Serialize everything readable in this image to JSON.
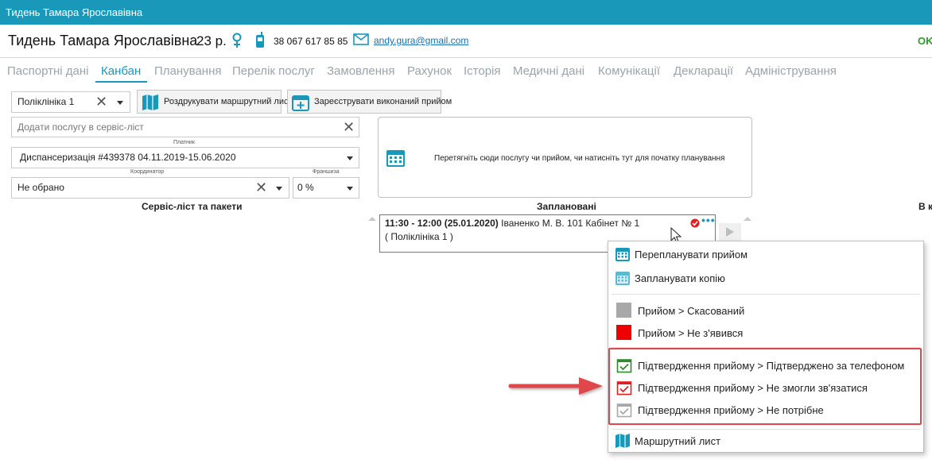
{
  "window": {
    "title": "Тидень Тамара Ярославівна"
  },
  "header": {
    "name": "Тидень Тамара Ярославівна",
    "age": "23 р.",
    "phone": "38 067 617 85 85",
    "email": "andy.gura@gmail.com",
    "status": "OK"
  },
  "tabs": [
    {
      "label": "Паспортні дані",
      "active": false
    },
    {
      "label": "Канбан",
      "active": true
    },
    {
      "label": "Планування",
      "active": false
    },
    {
      "label": "Перелік послуг",
      "active": false
    },
    {
      "label": "Замовлення",
      "active": false
    },
    {
      "label": "Рахунок",
      "active": false
    },
    {
      "label": "Історія",
      "active": false
    },
    {
      "label": "Медичні дані",
      "active": false
    },
    {
      "label": "Комунікації",
      "active": false
    },
    {
      "label": "Декларації",
      "active": false
    },
    {
      "label": "Адміністрування",
      "active": false
    }
  ],
  "toolbar": {
    "clinic_value": "Поліклініка 1",
    "print_route_label": "Роздрукувати маршрутний лист",
    "register_label": "Зареєструвати виконаний прийом"
  },
  "form": {
    "add_service_placeholder": "Додати послугу в сервіс-ліст",
    "payer_label": "Платник",
    "payer_value": "Диспансеризація #439378 04.11.2019-15.06.2020",
    "coordinator_label": "Координатор",
    "coordinator_value": "Не обрано",
    "franchise_label": "Франшиза",
    "franchise_value": "0 %"
  },
  "columns": {
    "service_list": "Сервіс-ліст та пакети",
    "planned": "Заплановані",
    "third": "В к"
  },
  "dropzone": {
    "message": "Перетягніть сюди послугу чи прийом, чи натисніть тут для початку планування"
  },
  "card": {
    "time": "11:30 - 12:00 (25.01.2020)",
    "details": "Іваненко М. В. 101 Кабінет № 1",
    "location": "( Поліклініка 1 )"
  },
  "context_menu": {
    "items": [
      {
        "label": "Перепланувати прийом",
        "icon": "calendar-icon"
      },
      {
        "label": "Запланувати копію",
        "icon": "calendar-copy-icon"
      },
      {
        "label": "Прийом > Скасований",
        "color": "#a8a8a8"
      },
      {
        "label": "Прийом > Не з'явився",
        "color": "#ee0000"
      },
      {
        "label": "Підтвердження прийому > Підтверджено за телефоном",
        "color": "#2f8a2f"
      },
      {
        "label": "Підтвердження прийому > Не змогли зв'язатися",
        "color": "#e02020"
      },
      {
        "label": "Підтвердження прийому > Не потрібне",
        "color": "#a8a8a8"
      },
      {
        "label": "Маршрутний лист",
        "icon": "map-icon"
      }
    ]
  },
  "colors": {
    "accent": "#1a98b9",
    "highlight": "#e0474c",
    "ok": "#2e9a2e"
  }
}
